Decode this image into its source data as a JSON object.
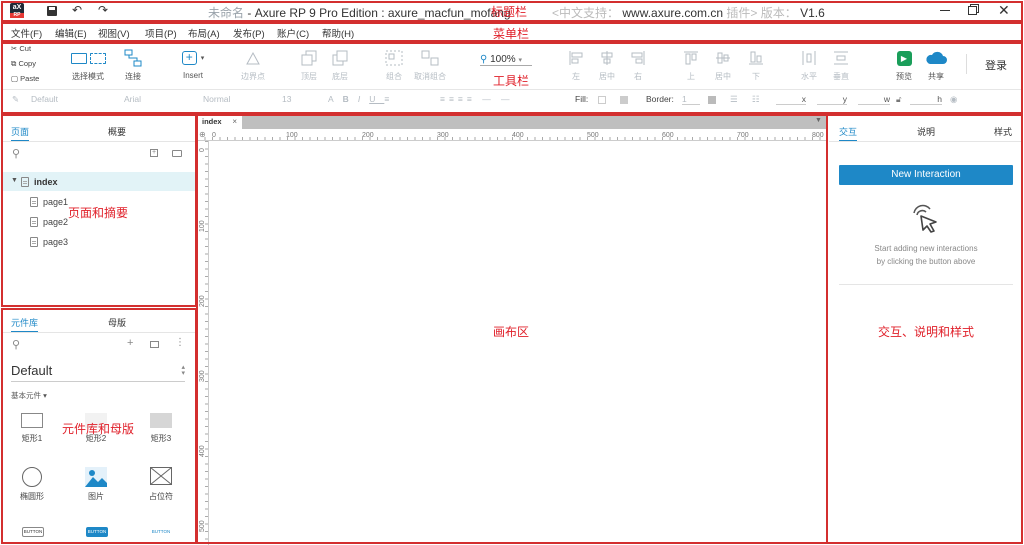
{
  "titlebar": {
    "logo_text": "aX",
    "logo_sub": "RP",
    "title_left": "未命名",
    "title_main": "- Axure RP 9 Pro Edition : axure_macfun_mofang",
    "title_mid": "<中文支持：",
    "title_url": "www.axure.com.cn",
    "title_right": "插件> 版本：",
    "version": "V1.6"
  },
  "menu": {
    "items": [
      "文件(F)",
      "编辑(E)",
      "视图(V)",
      "项目(P)",
      "布局(A)",
      "发布(P)",
      "账户(C)",
      "帮助(H)"
    ]
  },
  "toolbar": {
    "cut": "Cut",
    "copy": "Copy",
    "paste": "Paste",
    "select_mode": "选择模式",
    "connect": "连接",
    "insert": "Insert",
    "edit_points": "边界点",
    "top": "顶层",
    "bottom": "底层",
    "group": "组合",
    "ungroup": "取消组合",
    "zoom": "100%",
    "align_left": "左",
    "align_center": "居中",
    "align_right": "右",
    "align_top": "上",
    "align_middle": "居中",
    "align_bottom": "下",
    "distribute_h": "水平",
    "distribute_v": "垂直",
    "preview": "预览",
    "share": "共享",
    "login": "登录"
  },
  "format_bar": {
    "style": "Default",
    "font": "Arial",
    "weight": "Normal",
    "size": "13",
    "fill_label": "Fill:",
    "border_label": "Border:",
    "border_value": "1",
    "x_label": "x",
    "y_label": "y",
    "w_label": "w",
    "h_label": "h"
  },
  "pages_panel": {
    "tab_pages": "页面",
    "tab_outline": "概要",
    "root": "index",
    "pages": [
      "page1",
      "page2",
      "page3"
    ]
  },
  "library_panel": {
    "tab_library": "元件库",
    "tab_masters": "母版",
    "library_name": "Default",
    "section": "基本元件 ▾",
    "widgets": [
      "矩形1",
      "矩形2",
      "矩形3",
      "椭圆形",
      "图片",
      "占位符"
    ],
    "buttons": [
      "BUTTON",
      "BUTTON",
      "BUTTON"
    ]
  },
  "canvas": {
    "tab": "index",
    "ruler_h": [
      "0",
      "100",
      "200",
      "300",
      "400",
      "500",
      "600",
      "700",
      "800"
    ],
    "ruler_v": [
      "0",
      "100",
      "200",
      "300",
      "400",
      "500"
    ]
  },
  "right_panel": {
    "tab_interactions": "交互",
    "tab_notes": "说明",
    "tab_style": "样式",
    "new_interaction": "New Interaction",
    "hint_line1": "Start adding new interactions",
    "hint_line2": "by clicking the button above"
  },
  "annotations": {
    "title_bar": "标题栏",
    "menu_bar": "菜单栏",
    "tool_bar": "工具栏",
    "pages": "页面和摘要",
    "library": "元件库和母版",
    "canvas": "画布区",
    "right": "交互、说明和样式"
  },
  "colors": {
    "accent": "#1e88c7",
    "annotation": "#e0202a",
    "preview_green": "#1a9e5a"
  }
}
